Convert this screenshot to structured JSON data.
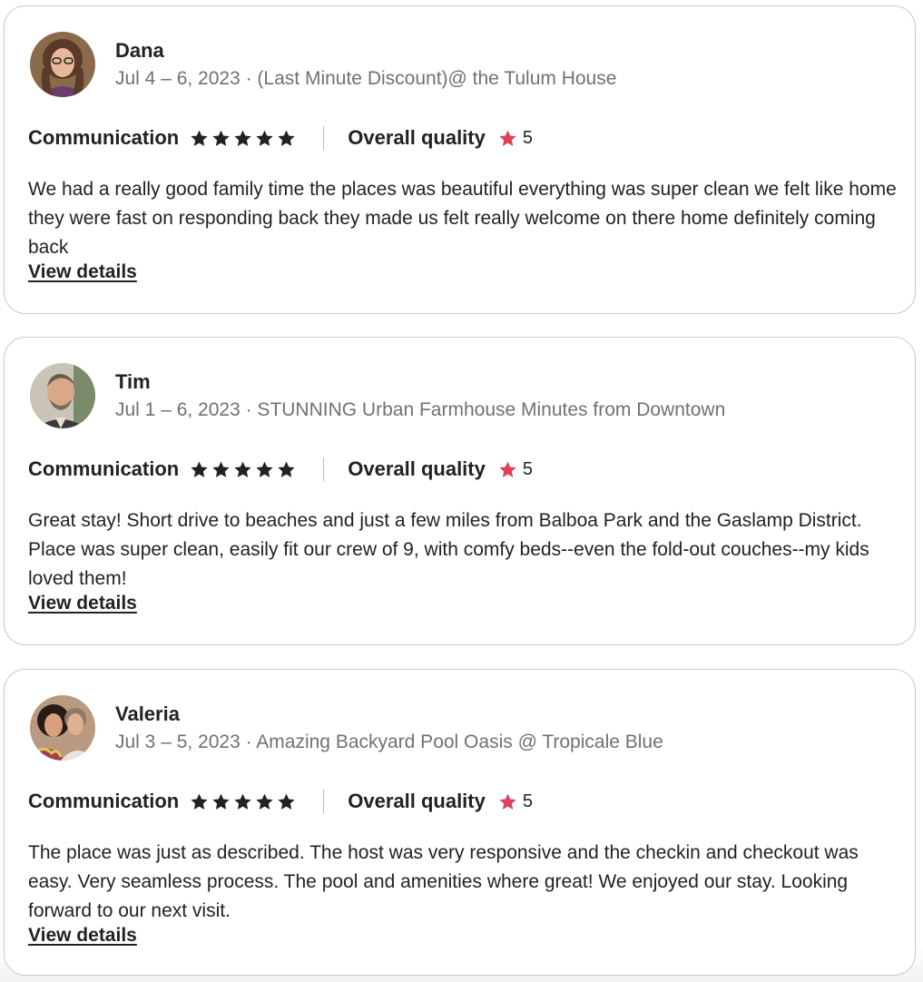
{
  "reviews": [
    {
      "reviewer": "Dana",
      "stay": "Jul 4 – 6, 2023 · (Last Minute Discount)@ the Tulum House",
      "communication_label": "Communication",
      "communication_stars": 5,
      "overall_label": "Overall quality",
      "overall_value": "5",
      "text": "We had a really good family time the places was beautiful everything was super clean we felt like home they were fast on responding back they made us felt really welcome on there home definitely coming back",
      "link": "View details"
    },
    {
      "reviewer": "Tim",
      "stay": "Jul 1 – 6, 2023 · STUNNING Urban Farmhouse Minutes from Downtown",
      "communication_label": "Communication",
      "communication_stars": 5,
      "overall_label": "Overall quality",
      "overall_value": "5",
      "text": "Great stay! Short drive to beaches and just a few miles from Balboa Park and the Gaslamp District. Place was super clean, easily fit our crew of 9, with comfy beds--even the fold-out couches--my kids loved them!",
      "link": "View details"
    },
    {
      "reviewer": "Valeria",
      "stay": "Jul 3 – 5, 2023 · Amazing Backyard Pool Oasis @ Tropicale Blue",
      "communication_label": "Communication",
      "communication_stars": 5,
      "overall_label": "Overall quality",
      "overall_value": "5",
      "text": "The place was just as described. The host was very responsive and the checkin and checkout was easy. Very seamless process. The pool and amenities where great! We enjoyed our stay. Looking forward to our next visit.",
      "link": "View details"
    }
  ],
  "icons": {
    "communication_star": "star-icon",
    "overall_star": "star-icon"
  },
  "colors": {
    "text_primary": "#222222",
    "text_secondary": "#717171",
    "star_dark": "#222222",
    "star_accent": "#e0415b",
    "card_border": "#c9c9c9"
  }
}
